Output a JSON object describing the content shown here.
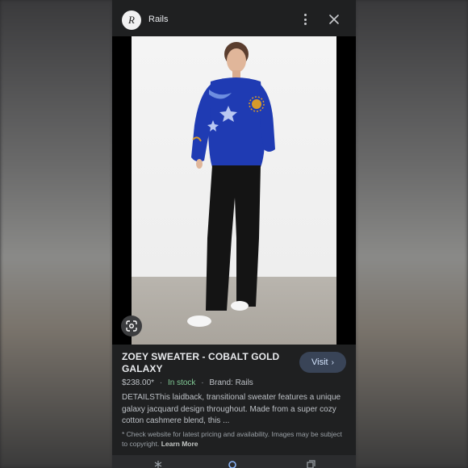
{
  "header": {
    "site_name": "Rails",
    "logo_glyph": "R"
  },
  "product": {
    "title": "ZOEY SWEATER - COBALT GOLD GALAXY",
    "price": "$238.00*",
    "stock": "In stock",
    "brand": "Brand: Rails",
    "description": "DETAILSThis laidback, transitional sweater features a unique galaxy jacquard design throughout. Made from a super cozy cotton cashmere blend, this ...",
    "visit_label": "Visit"
  },
  "disclaimer": {
    "text": "* Check website for latest pricing and availability. Images may be subject to copyright.",
    "link": "Learn More"
  },
  "colors": {
    "card_bg": "#1f2021",
    "visit_bg": "#394457",
    "stock_green": "#81c995",
    "sweater_blue": "#1f3bb3"
  },
  "icons": [
    "site-logo",
    "more-vert-icon",
    "close-icon",
    "google-lens-icon",
    "chevron-right-icon",
    "asterisk-icon",
    "search-icon",
    "tabs-icon"
  ]
}
